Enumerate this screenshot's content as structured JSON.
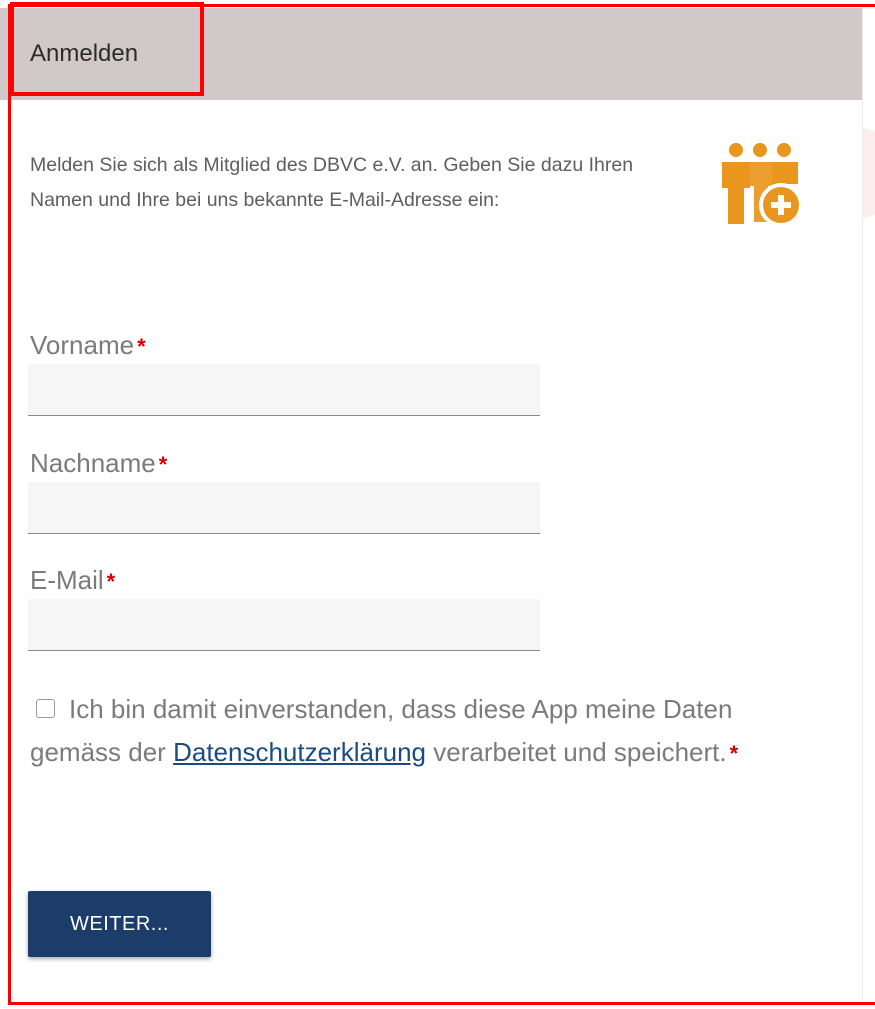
{
  "header": {
    "title": "Anmelden"
  },
  "intro": {
    "text": "Melden Sie sich als Mitglied des DBVC e.V. an. Geben Sie dazu Ihren Namen und Ihre bei uns bekannte E-Mail-Adresse ein:",
    "icon": "group-add-icon",
    "icon_color": "#e8961e"
  },
  "form": {
    "required_marker": "*",
    "firstname": {
      "label": "Vorname",
      "value": "",
      "placeholder": ""
    },
    "lastname": {
      "label": "Nachname",
      "value": "",
      "placeholder": ""
    },
    "email": {
      "label": "E-Mail",
      "value": "",
      "placeholder": ""
    },
    "consent": {
      "checked": false,
      "text_before": "Ich bin damit einverstanden, dass diese App meine Daten gemäss der",
      "link_text": "Datenschutzerklärung",
      "text_after": "verarbeitet und speichert."
    },
    "submit_label": "WEITER..."
  },
  "edge": {
    "letter": "A"
  },
  "colors": {
    "header_bg": "#d1c9c9",
    "button_bg": "#1c3c6a",
    "link": "#1b4b80",
    "required": "#d50000",
    "highlight": "#ff0000"
  }
}
